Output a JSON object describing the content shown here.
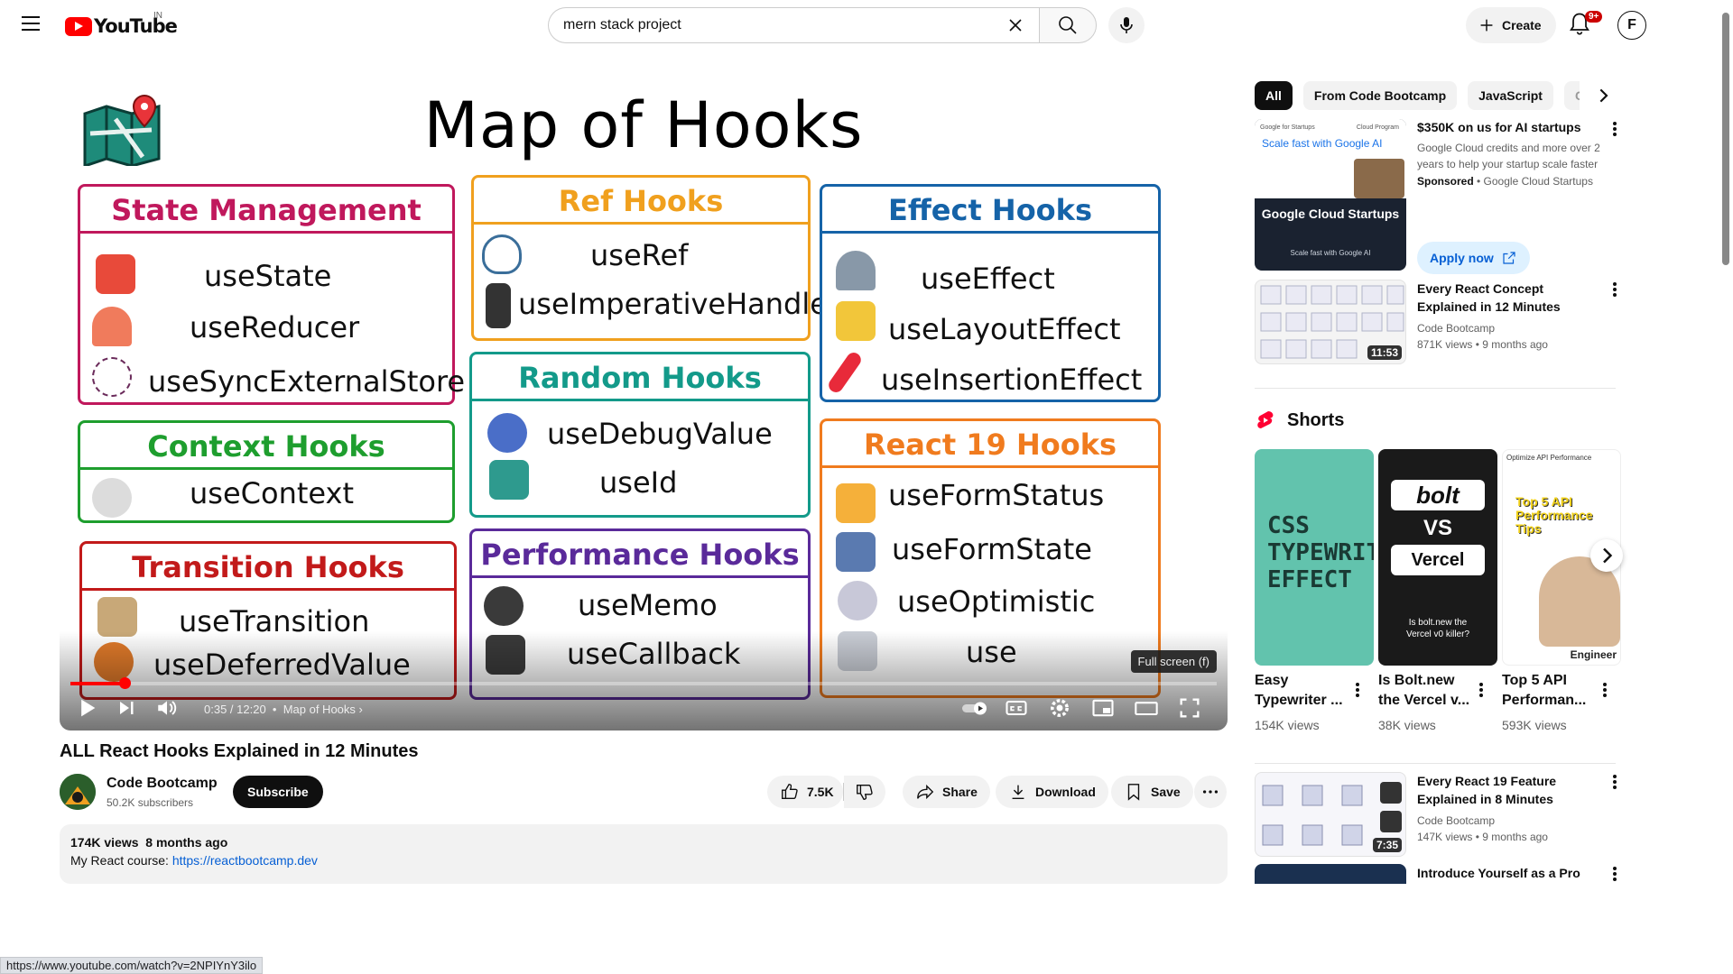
{
  "header": {
    "logo_text": "YouTube",
    "country_code": "IN",
    "search_value": "mern stack project",
    "create_label": "Create",
    "notif_badge": "9+",
    "avatar_letter": "F"
  },
  "player": {
    "thumbnail": {
      "title": "Map of Hooks",
      "cards": [
        {
          "title": "State Management",
          "color": "#c0185c",
          "hooks": [
            "useState",
            "useReducer",
            "useSyncExternalStore"
          ]
        },
        {
          "title": "Ref Hooks",
          "color": "#f0a01e",
          "hooks": [
            "useRef",
            "useImperativeHandle"
          ]
        },
        {
          "title": "Effect Hooks",
          "color": "#1563a8",
          "hooks": [
            "useEffect",
            "useLayoutEffect",
            "useInsertionEffect"
          ]
        },
        {
          "title": "Context Hooks",
          "color": "#1e9e2e",
          "hooks": [
            "useContext"
          ]
        },
        {
          "title": "Random Hooks",
          "color": "#139a8a",
          "hooks": [
            "useDebugValue",
            "useId"
          ]
        },
        {
          "title": "React 19 Hooks",
          "color": "#f07b1e",
          "hooks": [
            "useFormStatus",
            "useFormState",
            "useOptimistic",
            "use"
          ]
        },
        {
          "title": "Transition Hooks",
          "color": "#c21a1a",
          "hooks": [
            "useTransition",
            "useDeferredValue"
          ]
        },
        {
          "title": "Performance Hooks",
          "color": "#5a2a9a",
          "hooks": [
            "useMemo",
            "useCallback"
          ]
        }
      ]
    },
    "time_current": "0:35",
    "time_total": "12:20",
    "chapter": "Map of Hooks",
    "progress_fraction": 0.047,
    "tooltip": "Full screen (f)"
  },
  "video": {
    "title": "ALL React Hooks Explained in 12 Minutes",
    "channel": "Code Bootcamp",
    "subscribers": "50.2K subscribers",
    "subscribe_label": "Subscribe",
    "likes": "7.5K",
    "share_label": "Share",
    "download_label": "Download",
    "save_label": "Save",
    "views": "174K views",
    "age": "8 months ago",
    "desc_prefix": "My React course: ",
    "desc_link": "https://reactbootcamp.dev"
  },
  "sidebar": {
    "chips": [
      "All",
      "From Code Bootcamp",
      "JavaScript",
      "Cor"
    ],
    "ad": {
      "title": "$350K on us for AI startups",
      "desc": "Google Cloud credits and more over 2 years to help your startup scale faster",
      "sponsored": "Sponsored",
      "advertiser": "Google Cloud Startups",
      "apply_label": "Apply now",
      "thumb_header": "Google for Startups",
      "thumb_program": "Cloud Program",
      "thumb_tag": "Scale fast with Google AI",
      "thumb_brand": "Google Cloud Startups",
      "thumb_sub": "Scale fast with Google AI"
    },
    "videos": [
      {
        "title": "Every React Concept Explained in 12 Minutes",
        "channel": "Code Bootcamp",
        "views": "871K views",
        "age": "9 months ago",
        "duration": "11:53"
      },
      {
        "title": "Every React 19 Feature Explained in 8 Minutes",
        "channel": "Code Bootcamp",
        "views": "147K views",
        "age": "9 months ago",
        "duration": "7:35"
      },
      {
        "title": "Introduce Yourself as a Pro"
      }
    ],
    "shorts_label": "Shorts",
    "shorts": [
      {
        "title": "Easy Typewriter ...",
        "views": "154K views",
        "thumb_text": "CSS TYPEWRITER EFFECT"
      },
      {
        "title": "Is Bolt.new the Vercel v...",
        "views": "38K views",
        "thumb_text_1": "bolt",
        "thumb_text_2": "VS",
        "thumb_text_3": "Vercel",
        "thumb_caption": "Is bolt.new the Vercel v0 killer?"
      },
      {
        "title": "Top 5 API Performan...",
        "views": "593K views",
        "thumb_header": "Optimize API Performance",
        "thumb_text": "Top 5 API Performance Tips",
        "thumb_caption": "Engineer"
      }
    ]
  },
  "status_url": "https://www.youtube.com/watch?v=2NPIYnY3ilo"
}
